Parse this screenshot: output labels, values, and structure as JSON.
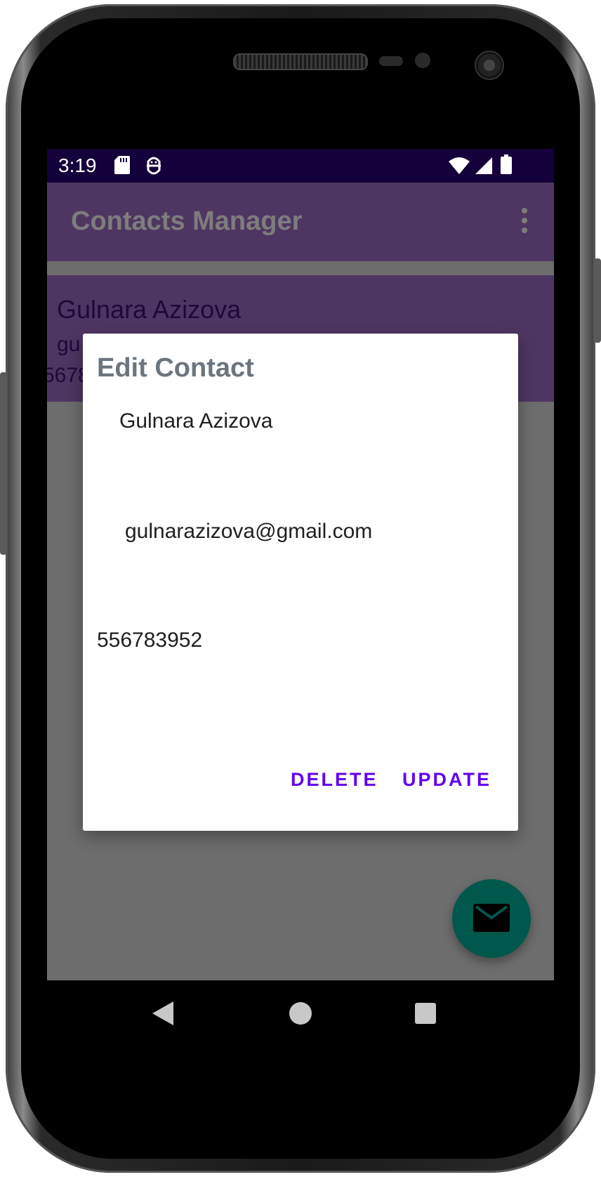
{
  "status_bar": {
    "time": "3:19",
    "icons": [
      "sd-card-icon",
      "android-debug-icon",
      "wifi-icon",
      "signal-icon",
      "battery-icon"
    ]
  },
  "app_bar": {
    "title": "Contacts Manager",
    "overflow_icon": "more-vert-icon"
  },
  "contact_list": {
    "items": [
      {
        "name": "Gulnara Azizova",
        "email": "gu",
        "phone": "5678"
      }
    ]
  },
  "dialog": {
    "title": "Edit Contact",
    "name_value": "Gulnara Azizova",
    "email_value": "gulnarazizova@gmail.com",
    "phone_value": "556783952",
    "delete_label": "DELETE",
    "update_label": "UPDATE"
  },
  "fab": {
    "icon": "email-icon"
  },
  "nav_bar": {
    "icons": [
      "back-icon",
      "home-icon",
      "recents-icon"
    ]
  },
  "colors": {
    "status_bar": "#14003a",
    "app_bar": "#4e3662",
    "accent": "#6200ee",
    "fab": "#00574b",
    "scrim": "#6d6d6d"
  }
}
